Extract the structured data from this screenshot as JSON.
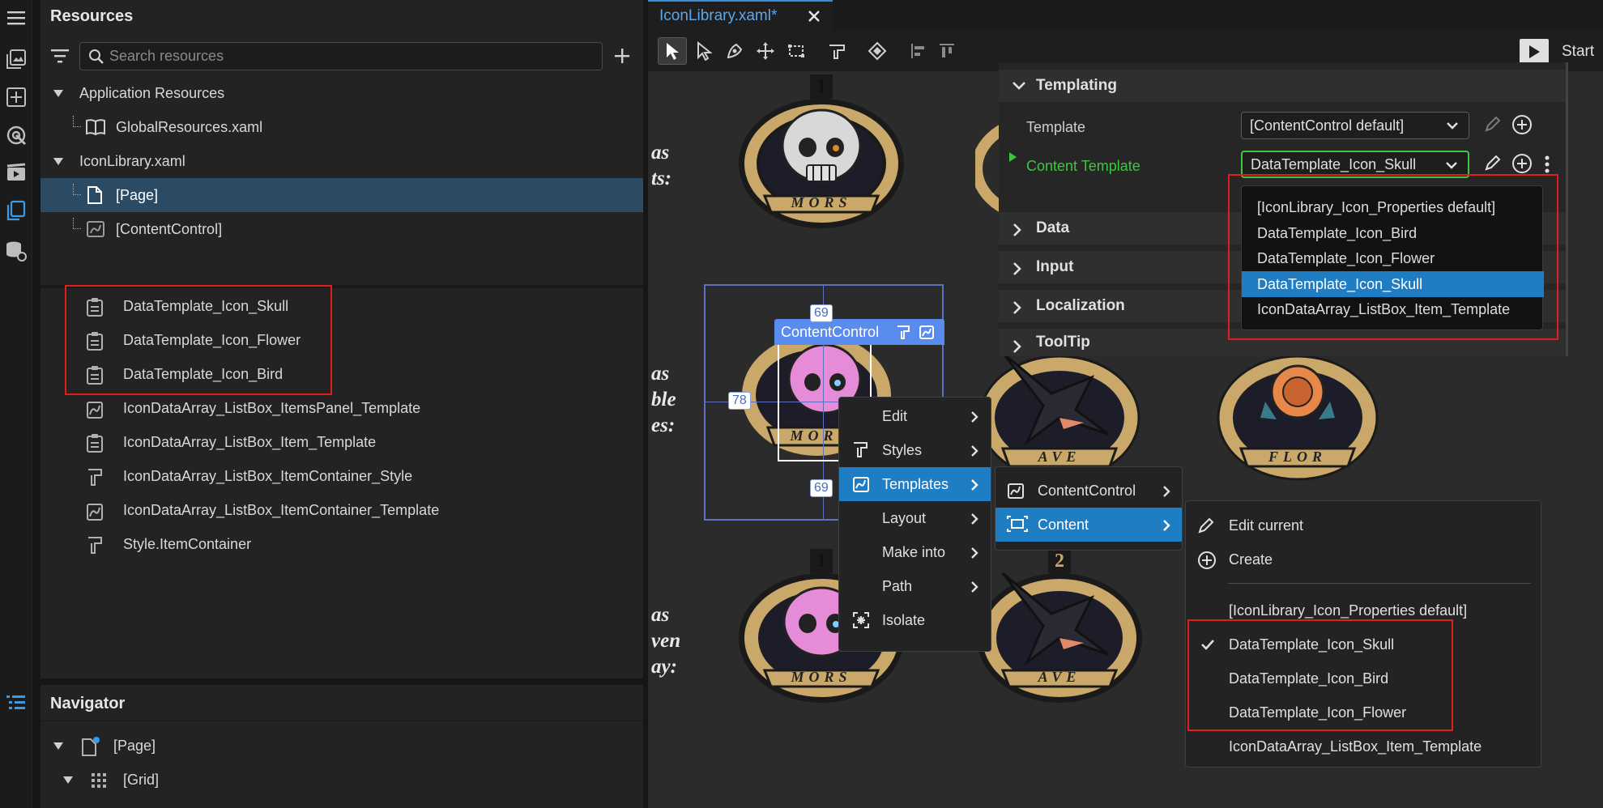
{
  "rail": {
    "icons": [
      "menu-icon",
      "gallery-icon",
      "add-box-icon",
      "palette-icon",
      "media-icon",
      "resources-icon",
      "database-link-icon",
      "navigator-icon"
    ]
  },
  "resources": {
    "title": "Resources",
    "search_placeholder": "Search resources",
    "tree": [
      {
        "label": "Application Resources"
      },
      {
        "label": "GlobalResources.xaml"
      },
      {
        "label": "IconLibrary.xaml"
      },
      {
        "label": "[Page]"
      },
      {
        "label": "[ContentControl]"
      }
    ],
    "items": [
      {
        "label": "DataTemplate_Icon_Skull",
        "icon": "data-template-icon"
      },
      {
        "label": "DataTemplate_Icon_Flower",
        "icon": "data-template-icon"
      },
      {
        "label": "DataTemplate_Icon_Bird",
        "icon": "data-template-icon"
      },
      {
        "label": "IconDataArray_ListBox_ItemsPanel_Template",
        "icon": "control-template-icon"
      },
      {
        "label": "IconDataArray_ListBox_Item_Template",
        "icon": "data-template-icon"
      },
      {
        "label": "IconDataArray_ListBox_ItemContainer_Style",
        "icon": "style-brush-icon"
      },
      {
        "label": "IconDataArray_ListBox_ItemContainer_Template",
        "icon": "control-template-icon"
      },
      {
        "label": "Style.ItemContainer",
        "icon": "style-brush-icon"
      }
    ]
  },
  "navigator": {
    "title": "Navigator",
    "items": [
      {
        "label": "[Page]"
      },
      {
        "label": "[Grid]"
      }
    ]
  },
  "editor": {
    "tab_title": "IconLibrary.xaml*",
    "start_label": "Start"
  },
  "canvas": {
    "side_text": [
      {
        "lines": [
          "as",
          "ts:"
        ]
      },
      {
        "lines": [
          "as",
          "ble",
          "es:"
        ]
      },
      {
        "lines": [
          "as",
          "ven",
          "ay:"
        ]
      }
    ],
    "badges": [
      {
        "number": "1",
        "banner": "MORS"
      },
      {
        "number": "",
        "banner": "MORS"
      },
      {
        "number": "",
        "banner": "AVE"
      },
      {
        "number": "",
        "banner": "FLOR"
      },
      {
        "number": "1",
        "banner": "MORS"
      },
      {
        "number": "2",
        "banner": "AVE"
      }
    ],
    "selection": {
      "label": "ContentControl",
      "top": "69",
      "left": "78",
      "bottom": "69"
    }
  },
  "properties": {
    "categories": [
      {
        "label": "Templating"
      },
      {
        "label": "Data"
      },
      {
        "label": "Input"
      },
      {
        "label": "Localization"
      },
      {
        "label": "ToolTip"
      }
    ],
    "template_label": "Template",
    "template_value": "[ContentControl default]",
    "content_template_label": "Content Template",
    "content_template_value": "DataTemplate_Icon_Skull",
    "dropdown_options": [
      {
        "label": "[IconLibrary_Icon_Properties default]"
      },
      {
        "label": "DataTemplate_Icon_Bird"
      },
      {
        "label": "DataTemplate_Icon_Flower"
      },
      {
        "label": "DataTemplate_Icon_Skull",
        "selected": true
      },
      {
        "label": "IconDataArray_ListBox_Item_Template"
      }
    ]
  },
  "context_menu": {
    "items": [
      {
        "label": "Edit"
      },
      {
        "label": "Styles"
      },
      {
        "label": "Templates"
      },
      {
        "label": "Layout"
      },
      {
        "label": "Make into"
      },
      {
        "label": "Path"
      },
      {
        "label": "Isolate"
      }
    ],
    "templates_submenu": [
      {
        "label": "ContentControl"
      },
      {
        "label": "Content"
      }
    ],
    "content_submenu": {
      "actions": [
        {
          "label": "Edit current"
        },
        {
          "label": "Create"
        }
      ],
      "options": [
        {
          "label": "[IconLibrary_Icon_Properties default]"
        },
        {
          "label": "DataTemplate_Icon_Skull",
          "checked": true
        },
        {
          "label": "DataTemplate_Icon_Bird"
        },
        {
          "label": "DataTemplate_Icon_Flower"
        },
        {
          "label": "IconDataArray_ListBox_Item_Template"
        }
      ]
    }
  },
  "colors": {
    "accent": "#1f7dc4",
    "highlight_red": "#e01e1e",
    "content_template_green": "#3ec63e",
    "selection_label": "#5a8cf0"
  }
}
